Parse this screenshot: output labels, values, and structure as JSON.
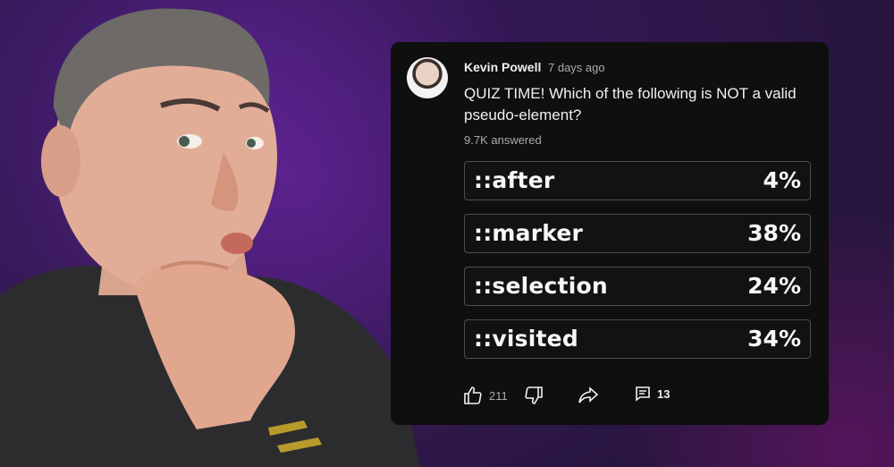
{
  "post": {
    "author": "Kevin Powell",
    "time": "7 days ago",
    "question": "QUIZ TIME! Which of the following is NOT a valid pseudo-element?",
    "answered": "9.7K answered"
  },
  "poll": {
    "options": [
      {
        "label": "::after",
        "percent": "4%"
      },
      {
        "label": "::marker",
        "percent": "38%"
      },
      {
        "label": "::selection",
        "percent": "24%"
      },
      {
        "label": "::visited",
        "percent": "34%"
      }
    ]
  },
  "actions": {
    "likes": "211",
    "comments": "13",
    "icons": [
      "thumbs-up-icon",
      "thumbs-down-icon",
      "share-icon",
      "comment-icon"
    ]
  },
  "colors": {
    "card_bg": "#0f0f0f",
    "option_border": "#4e4e4e",
    "text_primary": "#f1f1f1",
    "text_secondary": "#aaaaaa"
  }
}
